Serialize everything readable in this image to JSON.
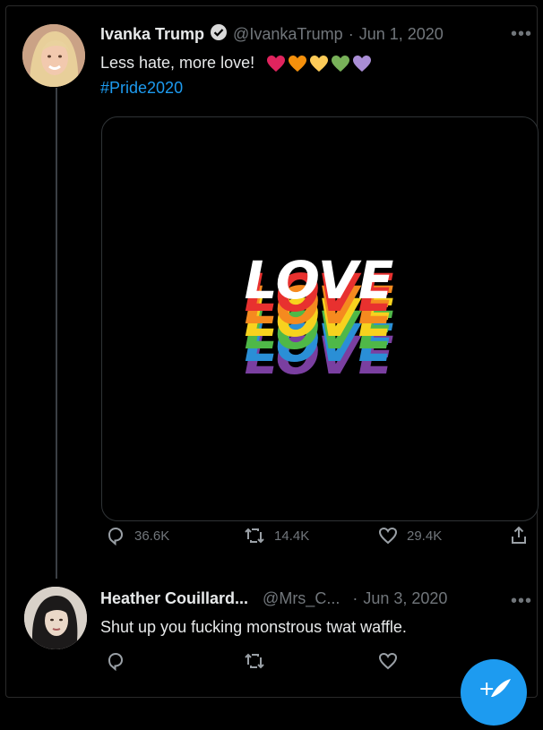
{
  "tweet1": {
    "name": "Ivanka Trump",
    "handle": "@IvankaTrump",
    "separator": "·",
    "date": "Jun 1, 2020",
    "text": "Less hate, more love!",
    "hashtag": "#Pride2020",
    "heart_colors": [
      "#e0245e",
      "#f4900c",
      "#fdcb58",
      "#78b159",
      "#aa8ed6"
    ],
    "media_text": "LOVE",
    "stats": {
      "replies": "36.6K",
      "retweets": "14.4K",
      "likes": "29.4K"
    }
  },
  "tweet2": {
    "name": "Heather Couillard...",
    "handle": "@Mrs_C...",
    "separator": "·",
    "date": "Jun 3, 2020",
    "text": "Shut up you fucking monstrous twat waffle."
  },
  "colors": {
    "accent": "#1d9bf0",
    "rainbow": [
      "#ffffff",
      "#e8312f",
      "#f58a1f",
      "#f7d21e",
      "#4fb848",
      "#2a8fd6",
      "#7a3fa0"
    ]
  }
}
